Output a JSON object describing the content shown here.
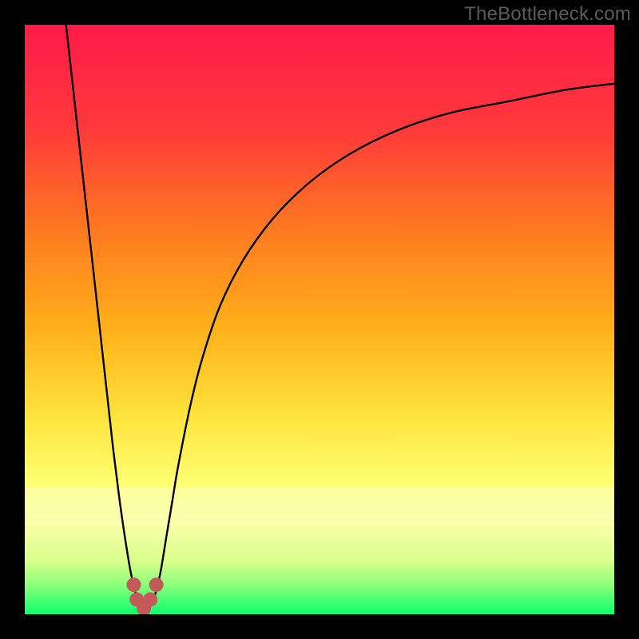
{
  "watermark": "TheBottleneck.com",
  "chart_data": {
    "type": "line",
    "title": "",
    "xlabel": "",
    "ylabel": "",
    "xlim": [
      0,
      100
    ],
    "ylim": [
      0,
      100
    ],
    "grid": false,
    "legend": false,
    "background_gradient": {
      "top_color": "#ff1a4a",
      "mid_colors": [
        "#ff5e2e",
        "#ffb21a",
        "#ffe23a",
        "#ffff73",
        "#d8ff8c"
      ],
      "bottom_color": "#0fff6e",
      "stops_percent": [
        0,
        22,
        47,
        63,
        78,
        90,
        97,
        100
      ]
    },
    "series": [
      {
        "name": "bottleneck-curve",
        "x": [
          7,
          8,
          9,
          10,
          11,
          12,
          13,
          14,
          15,
          16,
          17,
          18,
          19,
          20,
          21,
          22,
          23,
          24,
          25,
          26,
          28,
          30,
          33,
          37,
          42,
          48,
          55,
          63,
          72,
          82,
          92,
          100
        ],
        "y": [
          100,
          91,
          82,
          73,
          64,
          55,
          46,
          37,
          28,
          20,
          13,
          7,
          3,
          1,
          1,
          3,
          7,
          13,
          19,
          25,
          35,
          43,
          52,
          60,
          67,
          73,
          78,
          82,
          85,
          87,
          89,
          90
        ]
      }
    ],
    "markers": {
      "name": "valley-markers",
      "color": "#c25a5a",
      "radius_px": 9,
      "points": [
        {
          "x": 18.5,
          "y": 5
        },
        {
          "x": 19.0,
          "y": 2.5
        },
        {
          "x": 20.2,
          "y": 1
        },
        {
          "x": 21.3,
          "y": 2.5
        },
        {
          "x": 22.3,
          "y": 5
        }
      ]
    }
  }
}
